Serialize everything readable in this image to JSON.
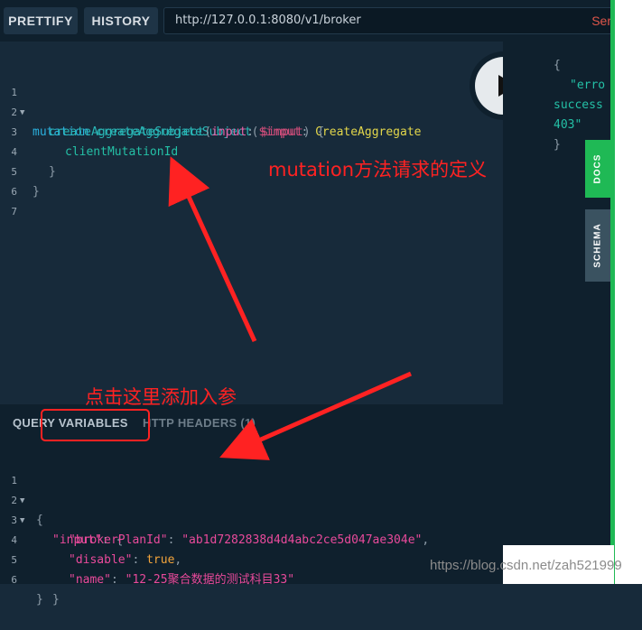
{
  "toolbar": {
    "prettify_label": "PRETTIFY",
    "history_label": "HISTORY",
    "url": "http://127.0.0.1:8080/v1/broker",
    "url_status": "Ser"
  },
  "editor": {
    "line_numbers": [
      "1",
      "2",
      "3",
      "4",
      "5",
      "6",
      "7"
    ],
    "l1_keyword": "mutation",
    "l1_name": "createAggregateSubject",
    "l1_paren": "(",
    "l1_var": "$input",
    "l1_colon": ": ",
    "l1_type": "CreateAggregate",
    "l2_field": "createAggregateSubject",
    "l2_paren": "(",
    "l2_arg": "input",
    "l2_colon": ": ",
    "l2_var": "$input",
    "l2_close": ") {",
    "l3_field": "clientMutationId",
    "l4_close": "}",
    "l5_close": "}"
  },
  "result": {
    "lines": [
      "{",
      "\"erro",
      "success",
      "403\"",
      "}"
    ]
  },
  "side_tabs": {
    "docs": "DOCS",
    "schema": "SCHEMA"
  },
  "variables": {
    "tab_query_variables": "QUERY VARIABLES",
    "tab_http_headers": "HTTP HEADERS (1)",
    "line_numbers": [
      "1",
      "2",
      "3",
      "4",
      "5",
      "6"
    ],
    "l1": "{",
    "l2_key": "\"input\"",
    "l2_rest": ": {",
    "l3_key": "\"brokerPlanId\"",
    "l3_value": "\"ab1d7282838d4d4abc2ce5d047ae304e\"",
    "l4_key": "\"disable\"",
    "l4_value": "true",
    "l5_key": "\"name\"",
    "l5_value": "\"12-25聚合数据的测试科目33\"",
    "l6": "}",
    "l7": "}"
  },
  "annotations": {
    "mutation_note": "mutation方法请求的定义",
    "params_note": "点击这里添加入参",
    "color": "#ff2222"
  },
  "watermark": "https://blog.csdn.net/zah521999",
  "colors": {
    "editor_bg": "#172a3a",
    "panel_bg": "#0f202d",
    "docs_tab": "#1fb955",
    "schema_tab": "#3a5260"
  }
}
